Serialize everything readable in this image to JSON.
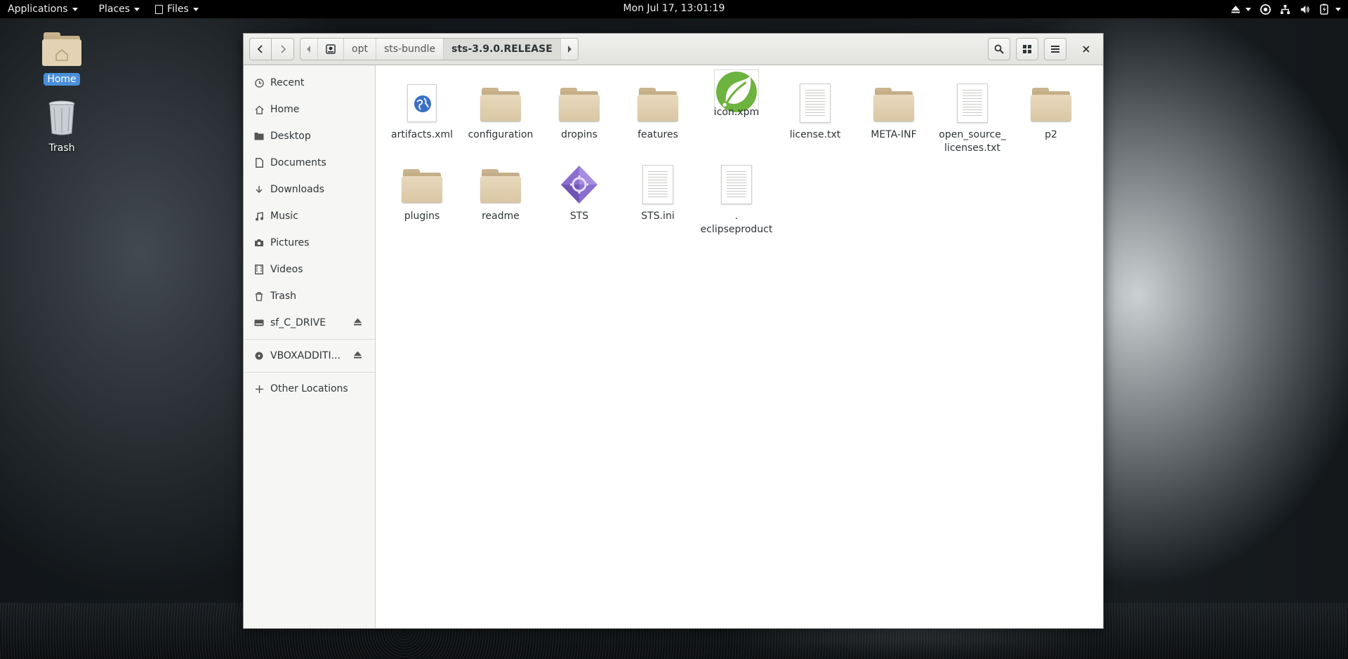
{
  "topbar": {
    "applications": "Applications",
    "places": "Places",
    "files": "Files",
    "clock": "Mon Jul 17, 13:01:19"
  },
  "desktop": {
    "icons": [
      {
        "label": "Home"
      },
      {
        "label": "Trash"
      }
    ]
  },
  "window": {
    "path": [
      "opt",
      "sts-bundle",
      "sts-3.9.0.RELEASE"
    ],
    "sidebar": [
      {
        "label": "Recent",
        "icon": "clock-icon"
      },
      {
        "label": "Home",
        "icon": "home-icon"
      },
      {
        "label": "Desktop",
        "icon": "folder-icon"
      },
      {
        "label": "Documents",
        "icon": "document-icon"
      },
      {
        "label": "Downloads",
        "icon": "download-icon"
      },
      {
        "label": "Music",
        "icon": "music-icon"
      },
      {
        "label": "Pictures",
        "icon": "camera-icon"
      },
      {
        "label": "Videos",
        "icon": "video-icon"
      },
      {
        "label": "Trash",
        "icon": "trash-icon"
      },
      {
        "label": "sf_C_DRIVE",
        "icon": "drive-icon"
      },
      {
        "label": "VBOXADDITI...",
        "icon": "disc-icon"
      },
      {
        "label": "Other Locations",
        "icon": "plus-icon"
      }
    ],
    "files": [
      {
        "name": "artifacts.xml",
        "type": "xml"
      },
      {
        "name": "configuration",
        "type": "folder"
      },
      {
        "name": "dropins",
        "type": "folder"
      },
      {
        "name": "features",
        "type": "folder"
      },
      {
        "name": "icon.xpm",
        "type": "image"
      },
      {
        "name": "license.txt",
        "type": "text"
      },
      {
        "name": "META-INF",
        "type": "folder"
      },
      {
        "name": "open_source_ licenses.txt",
        "type": "text"
      },
      {
        "name": "p2",
        "type": "folder"
      },
      {
        "name": "plugins",
        "type": "folder"
      },
      {
        "name": "readme",
        "type": "folder"
      },
      {
        "name": "STS",
        "type": "executable"
      },
      {
        "name": "STS.ini",
        "type": "text"
      },
      {
        "name": ". eclipseproduct",
        "type": "text"
      }
    ]
  },
  "colors": {
    "selection": "#4a90d9",
    "folder": "#d9c6a3",
    "spring_green": "#6db33f"
  }
}
